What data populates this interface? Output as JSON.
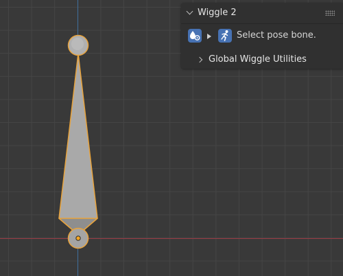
{
  "panel": {
    "title": "Wiggle 2",
    "status_text": "Select pose bone.",
    "subpanel_label": "Global Wiggle Utilities",
    "icons": {
      "physics": "physics-drop-icon",
      "armature": "armature-pose-icon",
      "expand": "triangle-right-icon",
      "collapse": "chevron-down-icon",
      "subpanel": "chevron-right-icon",
      "drag": "drag-handle-icon"
    }
  },
  "viewport": {
    "colors": {
      "background": "#393939",
      "grid": "#454545",
      "x_axis": "#9a3b44",
      "y_axis": "#3e6e9c",
      "bone_fill": "#a9a9a9",
      "bone_outline": "#e8a33c",
      "origin": "#f5a623"
    }
  }
}
